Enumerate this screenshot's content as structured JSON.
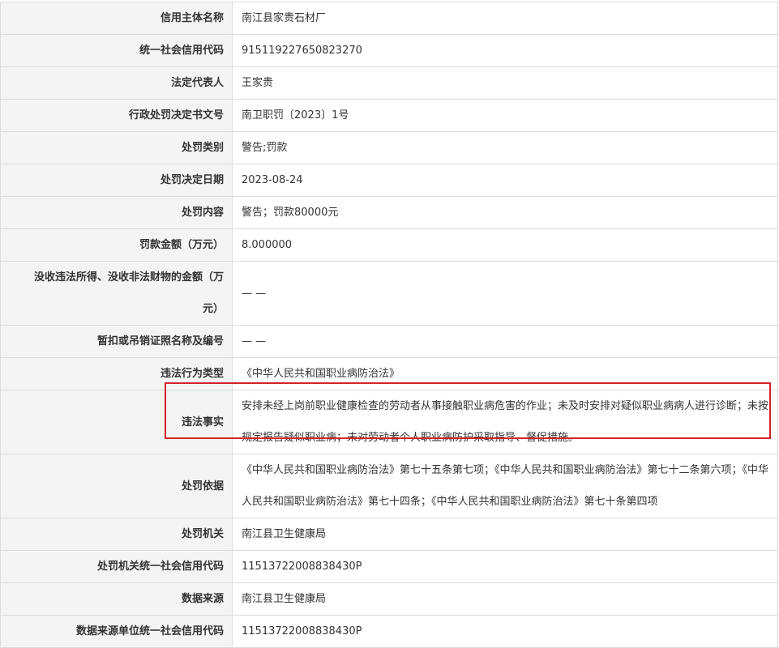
{
  "rows": [
    {
      "label": "信用主体名称",
      "value": "南江县家贵石材厂"
    },
    {
      "label": "统一社会信用代码",
      "value": "915119227650823270"
    },
    {
      "label": "法定代表人",
      "value": "王家贵"
    },
    {
      "label": "行政处罚决定书文号",
      "value": "南卫职罚〔2023〕1号"
    },
    {
      "label": "处罚类别",
      "value": "警告;罚款"
    },
    {
      "label": "处罚决定日期",
      "value": "2023-08-24"
    },
    {
      "label": "处罚内容",
      "value": "警告；罚款80000元"
    },
    {
      "label": "罚款金额（万元）",
      "value": "8.000000"
    },
    {
      "label": "没收违法所得、没收非法财物的金额（万元）",
      "value": "— —"
    },
    {
      "label": "暂扣或吊销证照名称及编号",
      "value": "— —"
    },
    {
      "label": "违法行为类型",
      "value": "《中华人民共和国职业病防治法》"
    },
    {
      "label": "违法事实",
      "value": "安排未经上岗前职业健康检查的劳动者从事接触职业病危害的作业；未及时安排对疑似职业病病人进行诊断；未按规定报告疑似职业病；未对劳动者个人职业病防护采取指导、督促措施。"
    },
    {
      "label": "处罚依据",
      "value": "《中华人民共和国职业病防治法》第七十五条第七项；《中华人民共和国职业病防治法》第七十二条第六项；《中华人民共和国职业病防治法》第七十四条；《中华人民共和国职业病防治法》第七十条第四项"
    },
    {
      "label": "处罚机关",
      "value": "南江县卫生健康局"
    },
    {
      "label": "处罚机关统一社会信用代码",
      "value": "11513722008838430P"
    },
    {
      "label": "数据来源",
      "value": "南江县卫生健康局"
    },
    {
      "label": "数据来源单位统一社会信用代码",
      "value": "11513722008838430P"
    }
  ],
  "colors": {
    "highlight_border": "#d3222a",
    "label_bg": "#f4f4f4",
    "border": "#dcdcdc"
  }
}
